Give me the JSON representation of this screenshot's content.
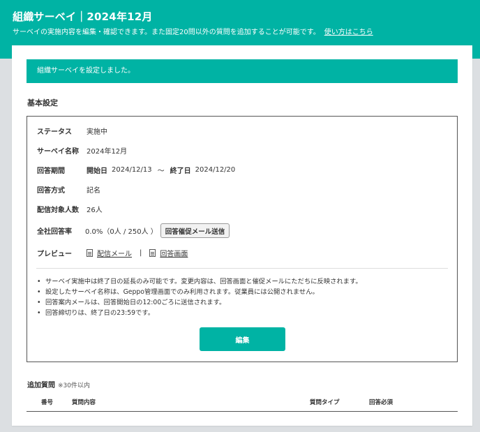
{
  "header": {
    "title": "組織サーベイ｜2024年12月",
    "subtitle": "サーベイの実施内容を編集・確認できます。また固定20問以外の質問を追加することが可能です。",
    "help_link": "使い方はこちら"
  },
  "alert": {
    "message": "組織サーベイを設定しました。"
  },
  "basic": {
    "title": "基本設定",
    "status": {
      "label": "ステータス",
      "value": "実施中"
    },
    "survey_name": {
      "label": "サーベイ名称",
      "value": "2024年12月"
    },
    "period": {
      "label": "回答期間",
      "start_label": "開始日",
      "start_value": "2024/12/13",
      "sep": "～",
      "end_label": "終了日",
      "end_value": "2024/12/20"
    },
    "method": {
      "label": "回答方式",
      "value": "記名"
    },
    "targets": {
      "label": "配信対象人数",
      "value": "26人"
    },
    "response_rate": {
      "label": "全社回答率",
      "value": "0.0%（0人 / 250人 ）",
      "button": "回答催促メール送信"
    },
    "preview": {
      "label": "プレビュー",
      "mail_link": "配信メール",
      "sep": "|",
      "screen_link": "回答画面"
    },
    "notes": [
      "サーベイ実施中は終了日の延長のみ可能です。変更内容は、回答画面と催促メールにただちに反映されます。",
      "設定したサーベイ名称は、Geppo管理画面でのみ利用されます。従業員には公開されません。",
      "回答案内メールは、回答開始日の12:00ごろに送信されます。",
      "回答締切りは、終了日の23:59です。"
    ],
    "edit_button": "編集"
  },
  "extra": {
    "title": "追加質問",
    "note": "※30件以内",
    "columns": [
      "番号",
      "質問内容",
      "質問タイプ",
      "回答必須"
    ]
  },
  "colors": {
    "accent": "#00b3a4",
    "background": "#dcdfe2"
  },
  "icons": {
    "preview_mail": "document-icon",
    "preview_screen": "document-icon"
  }
}
